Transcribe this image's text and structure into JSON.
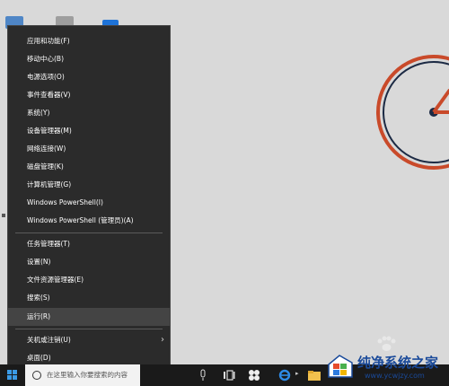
{
  "menu": {
    "items": [
      {
        "label": "应用和功能(F)"
      },
      {
        "label": "移动中心(B)"
      },
      {
        "label": "电源选项(O)"
      },
      {
        "label": "事件查看器(V)"
      },
      {
        "label": "系统(Y)"
      },
      {
        "label": "设备管理器(M)"
      },
      {
        "label": "网络连接(W)"
      },
      {
        "label": "磁盘管理(K)"
      },
      {
        "label": "计算机管理(G)"
      },
      {
        "label": "Windows PowerShell(I)"
      },
      {
        "label": "Windows PowerShell (管理员)(A)"
      },
      {
        "label": "任务管理器(T)"
      },
      {
        "label": "设置(N)"
      },
      {
        "label": "文件资源管理器(E)"
      },
      {
        "label": "搜索(S)"
      },
      {
        "label": "运行(R)"
      },
      {
        "label": "关机或注销(U)"
      },
      {
        "label": "桌面(D)"
      }
    ],
    "highlighted": "运行(R)"
  },
  "taskbar": {
    "search_placeholder": "在这里输入你要搜索的内容"
  },
  "watermark": {
    "name": "纯净系统之家",
    "url": "www.ycwjzy.com"
  },
  "colors": {
    "menu_bg": "#2b2b2b",
    "menu_highlight": "#444444",
    "taskbar_bg": "#1a1a1a",
    "desktop_bg": "#d9d9d9",
    "bike_red": "#c94a2a",
    "start_blue": "#3b9be6"
  }
}
